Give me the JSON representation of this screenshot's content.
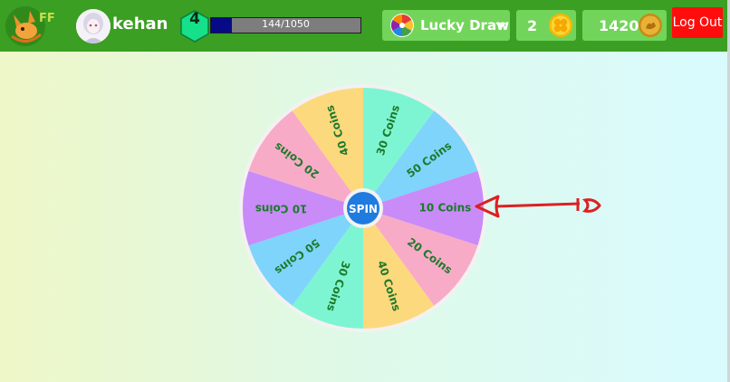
{
  "header": {
    "logo_text": "FF",
    "username": "kehan",
    "level": "4",
    "xp_text": "144/1050",
    "xp_progress": 0.137,
    "lucky_draw_label": "Lucky Draw",
    "tickets": "2",
    "coins": "1420",
    "logout_label": "Log Out"
  },
  "wheel": {
    "spin_label": "SPIN",
    "segments": [
      {
        "label": "30 Coins",
        "color": "#7ef5d2"
      },
      {
        "label": "50 Coins",
        "color": "#7ed4fa"
      },
      {
        "label": "10 Coins",
        "color": "#c98bf8"
      },
      {
        "label": "20 Coins",
        "color": "#f8abc7"
      },
      {
        "label": "40 Coins",
        "color": "#fdd97d"
      },
      {
        "label": "30 Coins",
        "color": "#7ef5d2"
      },
      {
        "label": "50 Coins",
        "color": "#7ed4fa"
      },
      {
        "label": "10 Coins",
        "color": "#c98bf8"
      },
      {
        "label": "20 Coins",
        "color": "#f8abc7"
      },
      {
        "label": "40 Coins",
        "color": "#fdd97d"
      }
    ]
  },
  "colors": {
    "topbar": "#3a9f22",
    "button_bg": "#73d45b",
    "logout_bg": "#ff0d0d",
    "level_badge": "#16e08a",
    "label_text": "#1d7a2b",
    "spin_button": "#1f7be0",
    "pointer": "#dd2020"
  },
  "icons": {
    "logo": "fox-logo-icon",
    "lucky": "color-wheel-icon",
    "ticket": "clover-coin-icon",
    "coin": "gold-coin-icon"
  }
}
